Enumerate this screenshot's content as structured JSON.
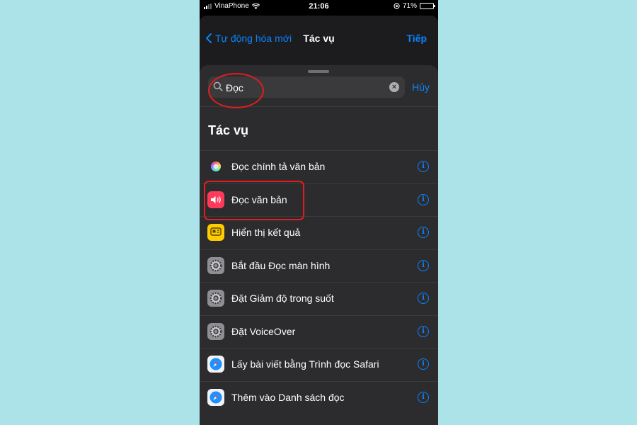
{
  "status_bar": {
    "carrier": "VinaPhone",
    "time": "21:06",
    "battery": "71%",
    "battery_level": 0.71
  },
  "nav": {
    "back_label": "Tự động hóa mới",
    "title": "Tác vụ",
    "next_label": "Tiếp"
  },
  "search": {
    "value": "Đọc",
    "cancel_label": "Hủy"
  },
  "section_title": "Tác vụ",
  "actions": [
    {
      "label": "Đọc chính tả văn bản",
      "icon": "dictation-icon"
    },
    {
      "label": "Đọc văn bản",
      "icon": "speaker-icon"
    },
    {
      "label": "Hiển thị kết quả",
      "icon": "show-result-icon"
    },
    {
      "label": "Bắt đầu Đọc màn hình",
      "icon": "settings-gear-icon"
    },
    {
      "label": "Đặt Giảm độ trong suốt",
      "icon": "settings-gear-icon"
    },
    {
      "label": "Đặt VoiceOver",
      "icon": "settings-gear-icon"
    },
    {
      "label": "Lấy bài viết bằng Trình đọc Safari",
      "icon": "safari-icon"
    },
    {
      "label": "Thêm vào Danh sách đọc",
      "icon": "safari-icon"
    }
  ],
  "colors": {
    "accent": "#0a84ff",
    "highlight": "#e11d1d",
    "sheet": "#2c2c2e"
  }
}
